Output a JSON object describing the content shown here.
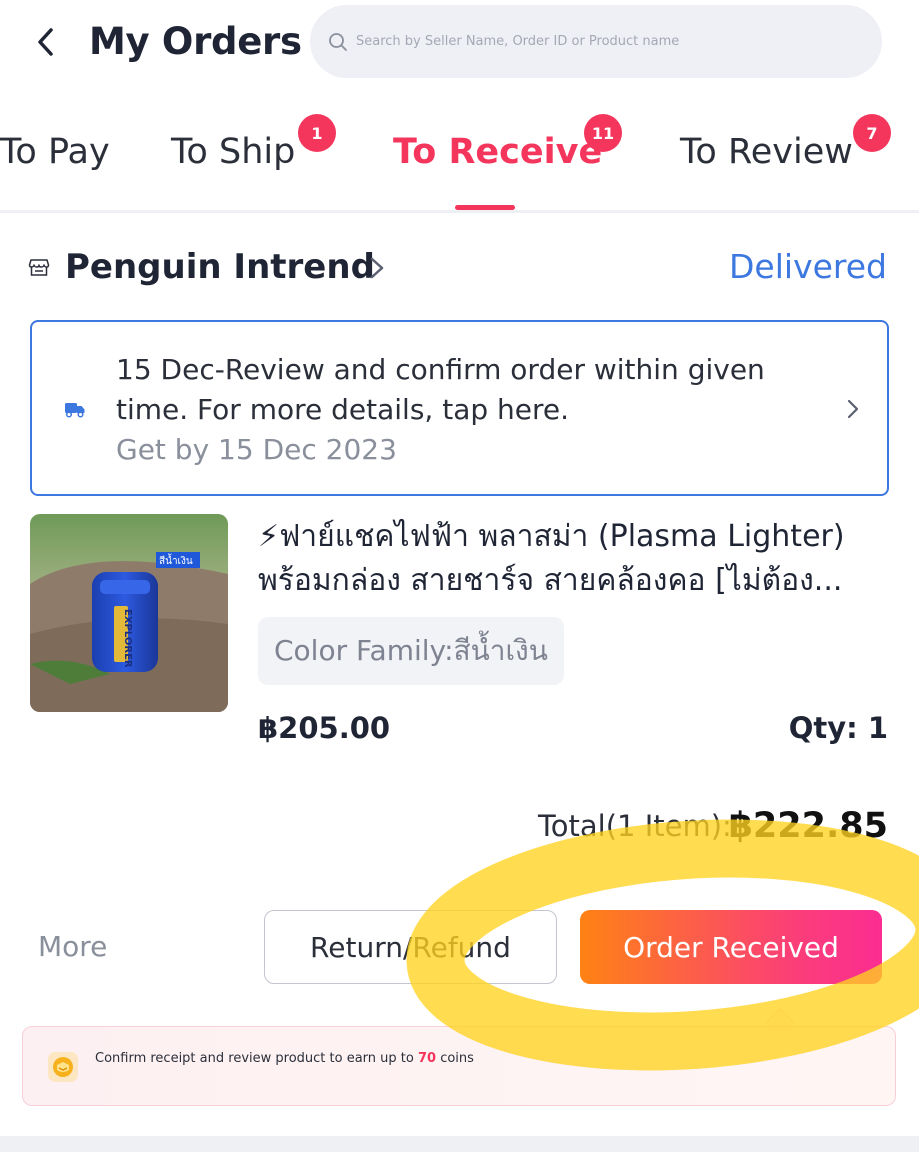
{
  "header": {
    "title": "My Orders",
    "search_placeholder": "Search by Seller Name, Order ID or Product name"
  },
  "tabs": [
    {
      "label": "To Pay",
      "badge": ""
    },
    {
      "label": "To Ship",
      "badge": "1"
    },
    {
      "label": "To Receive",
      "badge": "11",
      "active": true
    },
    {
      "label": "To Review",
      "badge": "7"
    }
  ],
  "order": {
    "shop_name": "Penguin Intrend",
    "status": "Delivered",
    "notice": {
      "line1": "15 Dec-Review and confirm order within given",
      "line2": "time. For more details, tap here.",
      "line3": "Get by 15 Dec 2023"
    },
    "product": {
      "title_line1": "⚡ฟาย์แชคไฟฟ้า พลาสม่า (Plasma Lighter)",
      "title_line2": "พร้อมกล่อง สายชาร์จ สายคล้องคอ [ไม่ต้อง...",
      "image_tag": "สีน้ำเงิน",
      "image_brand": "EXPLORER",
      "variant": "Color Family:สีน้ำเงิน",
      "price": "฿205.00",
      "qty": "Qty: 1"
    },
    "total_label": "Total(1 Item):",
    "total_value": "฿222.85",
    "actions": {
      "more": "More",
      "return_refund": "Return/Refund",
      "order_received": "Order Received"
    },
    "coins_banner": {
      "text_before": "Confirm receipt and review product to earn up to ",
      "amount": "70",
      "text_after": " coins"
    }
  },
  "colors": {
    "accent": "#f5365c",
    "status_blue": "#3d77e0",
    "button_gradient_start": "#fe8214",
    "button_gradient_end": "#fb2d92",
    "highlight": "#ffd21f"
  },
  "icons": [
    "back-arrow-icon",
    "search-icon",
    "shop-icon",
    "chevron-right-icon",
    "truck-icon",
    "coin-icon"
  ]
}
